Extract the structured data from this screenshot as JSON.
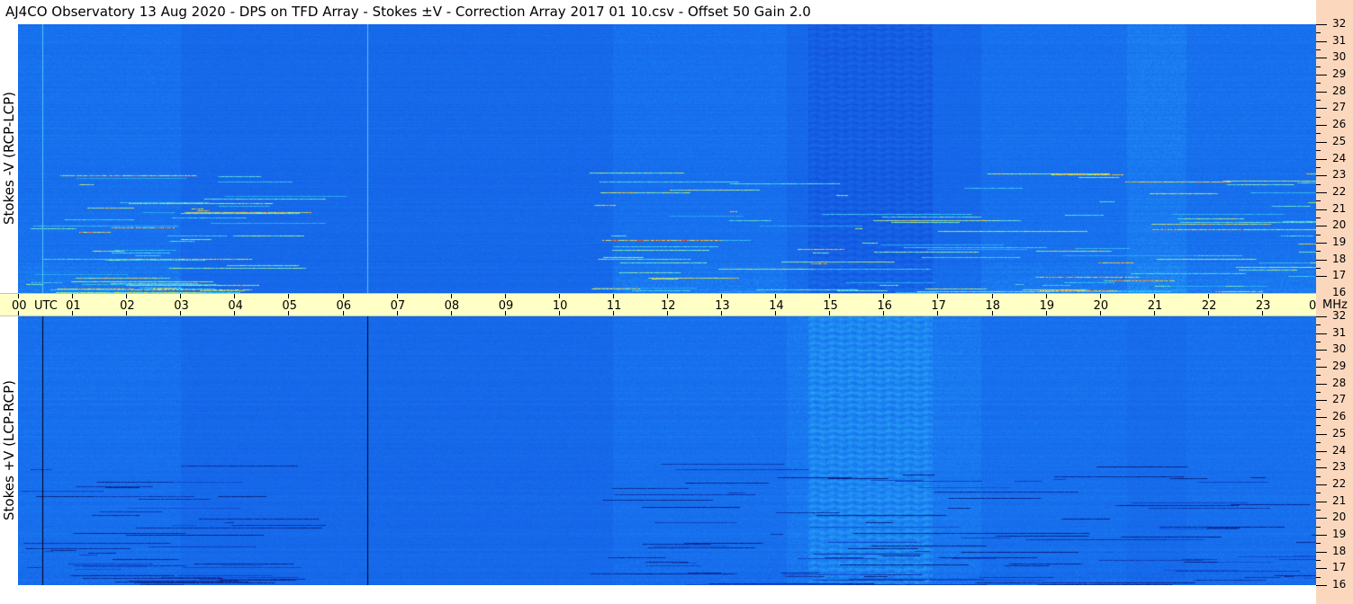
{
  "header": {
    "title": "AJ4CO Observatory  13 Aug 2020  -  DPS on TFD Array  -  Stokes ±V  -  Correction Array 2017 01 10.csv  -  Offset 50  Gain 2.0"
  },
  "colors": {
    "background_blue": "#1a6ef0",
    "time_bar": "#ffffc6",
    "right_strip": "#fbd8bd"
  },
  "chart_data": {
    "type": "heatmap",
    "title": "AJ4CO Observatory  13 Aug 2020  -  DPS on TFD Array  -  Stokes ±V  -  Correction Array 2017 01 10.csv  -  Offset 50  Gain 2.0",
    "x_axis": {
      "unit_label": "UTC",
      "tick_labels": [
        "00",
        "01",
        "02",
        "03",
        "04",
        "05",
        "06",
        "07",
        "08",
        "09",
        "10",
        "11",
        "12",
        "13",
        "14",
        "15",
        "16",
        "17",
        "18",
        "19",
        "20",
        "21",
        "22",
        "23",
        "00"
      ],
      "range_hours": [
        0,
        24
      ]
    },
    "y_axis": {
      "unit_label": "MHz",
      "tick_labels": [
        "16",
        "17",
        "18",
        "19",
        "20",
        "21",
        "22",
        "23",
        "24",
        "25",
        "26",
        "27",
        "28",
        "29",
        "30",
        "31",
        "32"
      ],
      "range_mhz": [
        16,
        32
      ]
    },
    "panels": [
      {
        "name": "top",
        "ylabel": "Stokes -V (RCP-LCP)"
      },
      {
        "name": "bottom",
        "ylabel": "Stokes +V (LCP-RCP)"
      }
    ],
    "events_utc_hours": [
      0.45,
      6.45
    ]
  }
}
